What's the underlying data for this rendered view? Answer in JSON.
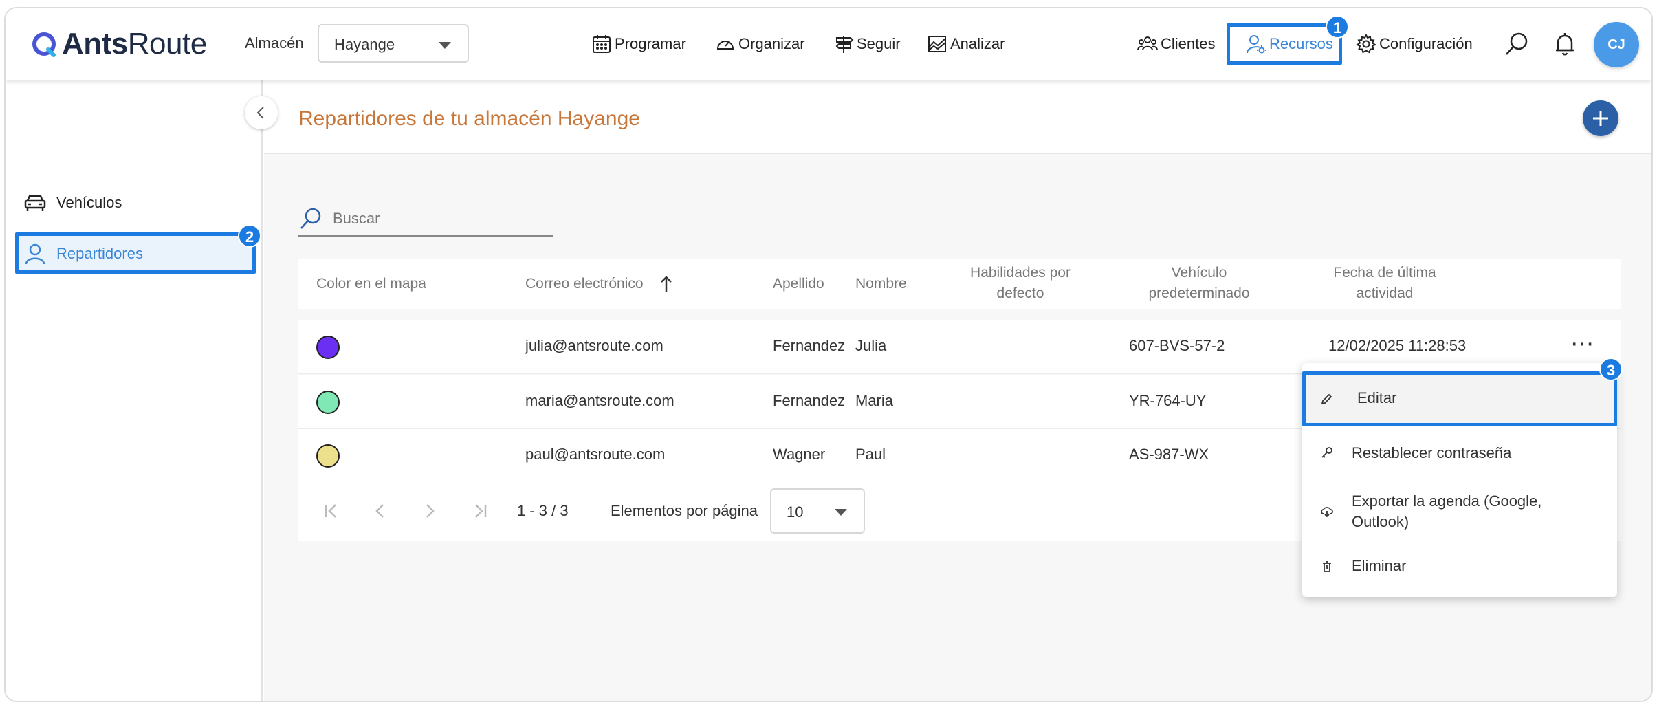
{
  "brand": {
    "name_bold": "Ants",
    "name_regular": "Route"
  },
  "header": {
    "warehouse_label": "Almacén",
    "warehouse_value": "Hayange",
    "nav": [
      {
        "label": "Programar",
        "icon": "calendar-icon"
      },
      {
        "label": "Organizar",
        "icon": "gauge-icon"
      },
      {
        "label": "Seguir",
        "icon": "signpost-icon"
      },
      {
        "label": "Analizar",
        "icon": "chart-icon"
      },
      {
        "label": "Clientes",
        "icon": "people-icon"
      },
      {
        "label": "Recursos",
        "icon": "user-gear-icon",
        "active": true
      },
      {
        "label": "Configuración",
        "icon": "gear-icon"
      }
    ],
    "avatar_initials": "CJ"
  },
  "annotations": {
    "badge1": "1",
    "badge2": "2",
    "badge3": "3"
  },
  "sidebar": {
    "items": [
      {
        "label": "Vehículos",
        "icon": "car-icon"
      },
      {
        "label": "Repartidores",
        "icon": "user-icon",
        "active": true
      }
    ]
  },
  "page": {
    "title": "Repartidores de tu almacén Hayange",
    "search_placeholder": "Buscar"
  },
  "table": {
    "columns": {
      "color": "Color en el mapa",
      "email": "Correo electrónico",
      "lastname": "Apellido",
      "firstname": "Nombre",
      "skills_l1": "Habilidades por",
      "skills_l2": "defecto",
      "vehicle_l1": "Vehículo",
      "vehicle_l2": "predeterminado",
      "activity_l1": "Fecha de última",
      "activity_l2": "actividad"
    },
    "rows": [
      {
        "color": "#6a2ff2",
        "email": "julia@antsroute.com",
        "lastname": "Fernandez",
        "firstname": "Julia",
        "vehicle": "607-BVS-57-2",
        "activity": "12/02/2025 11:28:53"
      },
      {
        "color": "#7fe8b4",
        "email": "maria@antsroute.com",
        "lastname": "Fernandez",
        "firstname": "Maria",
        "vehicle": "YR-764-UY",
        "activity": ""
      },
      {
        "color": "#ece08c",
        "email": "paul@antsroute.com",
        "lastname": "Wagner",
        "firstname": "Paul",
        "vehicle": "AS-987-WX",
        "activity": ""
      }
    ],
    "row_menu": "⋯"
  },
  "pagination": {
    "range": "1 - 3 / 3",
    "per_page_label": "Elementos por página",
    "per_page_value": "10"
  },
  "menu": {
    "edit": "Editar",
    "reset_password": "Restablecer contraseña",
    "export_l1": "Exportar la agenda (Google,",
    "export_l2": "Outlook)",
    "delete": "Eliminar"
  },
  "colors": {
    "accent": "#3a86d6",
    "highlight": "#1b7be0",
    "title": "#c8773b",
    "add_button": "#2b5fa6"
  }
}
